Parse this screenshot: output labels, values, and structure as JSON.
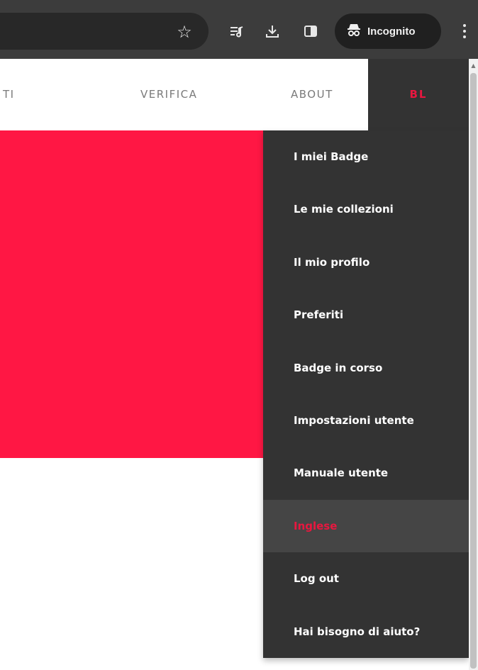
{
  "browser": {
    "incognito_label": "Incognito",
    "icons": [
      "star-icon",
      "reading-list-icon",
      "download-icon",
      "side-panel-icon",
      "incognito-icon",
      "more-menu-icon"
    ]
  },
  "nav": {
    "partial_item": "TI",
    "verifica": "VERIFICA",
    "about": "ABOUT",
    "user_initials": "BL"
  },
  "menu": {
    "items": [
      {
        "label": "I miei Badge"
      },
      {
        "label": "Le mie collezioni"
      },
      {
        "label": "Il mio profilo"
      },
      {
        "label": "Preferiti"
      },
      {
        "label": "Badge in corso"
      },
      {
        "label": "Impostazioni utente"
      },
      {
        "label": "Manuale utente"
      },
      {
        "label": "Inglese",
        "active": true
      },
      {
        "label": "Log out"
      },
      {
        "label": "Hai bisogno di aiuto?"
      }
    ]
  },
  "colors": {
    "accent": "#e8173f",
    "hero": "#ff1744",
    "menu_bg": "#333333",
    "menu_active_bg": "#454545",
    "chrome_bg": "#3c3c3c"
  }
}
